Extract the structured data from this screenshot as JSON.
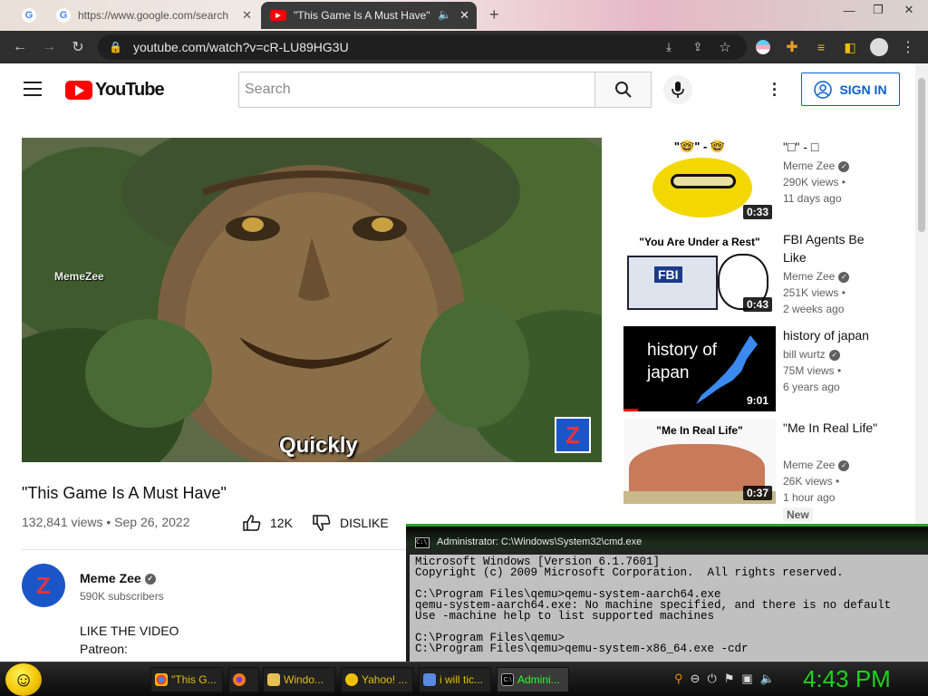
{
  "browser": {
    "tabs": [
      {
        "label": "https://www.google.com/search",
        "icon": "google-icon"
      },
      {
        "label": "\"This Game Is A Must Have\"",
        "icon": "youtube-icon"
      }
    ],
    "new_tab_glyph": "+",
    "url": "youtube.com/watch?v=cR-LU89HG3U"
  },
  "youtube": {
    "logo_text": "YouTube",
    "search_placeholder": "Search",
    "signin_label": "SIGN IN",
    "video": {
      "caption": "Quickly",
      "watermark": "MemeZee",
      "title": "\"This Game Is A Must Have\"",
      "meta": "132,841 views • Sep 26, 2022",
      "likes": "12K",
      "dislike_label": "DISLIKE"
    },
    "channel": {
      "name": "Meme Zee",
      "subscribers": "590K subscribers",
      "avatar_letter": "Z",
      "description_1": "LIKE THE VIDEO",
      "description_2": "Patreon:"
    },
    "recommendations": [
      {
        "title": "\"□\" - □",
        "channel": "Meme Zee",
        "views": "290K views •",
        "age": "11 days ago",
        "duration": "0:33",
        "thumb_text": "\"🤓\" - 🤓"
      },
      {
        "title": "FBI Agents Be Like",
        "channel": "Meme Zee",
        "views": "251K views •",
        "age": "2 weeks ago",
        "duration": "0:43",
        "thumb_text": "\"You Are Under a Rest\""
      },
      {
        "title": "history of japan",
        "channel": "bill wurtz",
        "views": "75M views •",
        "age": "6 years ago",
        "duration": "9:01",
        "thumb_text": "history of japan"
      },
      {
        "title": "\"Me In Real Life\"",
        "channel": "Meme Zee",
        "views": "26K views •",
        "age": "1 hour ago",
        "duration": "0:37",
        "thumb_text": "\"Me In Real Life\"",
        "badge": "New"
      }
    ]
  },
  "cmd": {
    "title": "Administrator: C:\\Windows\\System32\\cmd.exe",
    "lines": "Microsoft Windows [Version 6.1.7601]\nCopyright (c) 2009 Microsoft Corporation.  All rights reserved.\n\nC:\\Program Files\\qemu>qemu-system-aarch64.exe\nqemu-system-aarch64.exe: No machine specified, and there is no default\nUse -machine help to list supported machines\n\nC:\\Program Files\\qemu>\nC:\\Program Files\\qemu>qemu-system-x86_64.exe -cdr"
  },
  "taskbar": {
    "items": [
      {
        "label": "\"This G...",
        "icon": "chrome-icon"
      },
      {
        "label": "",
        "icon": "firefox-icon"
      },
      {
        "label": "Windo...",
        "icon": "folder-icon"
      },
      {
        "label": "Yahoo! ...",
        "icon": "yahoo-icon"
      },
      {
        "label": "i will tic...",
        "icon": "window-icon"
      },
      {
        "label": "Admini...",
        "icon": "cmd-icon"
      }
    ],
    "clock": "4:43 PM"
  },
  "colors": {
    "yt_red": "#ff0000",
    "link_blue": "#065fd4",
    "clock_green": "#1bd51b"
  }
}
